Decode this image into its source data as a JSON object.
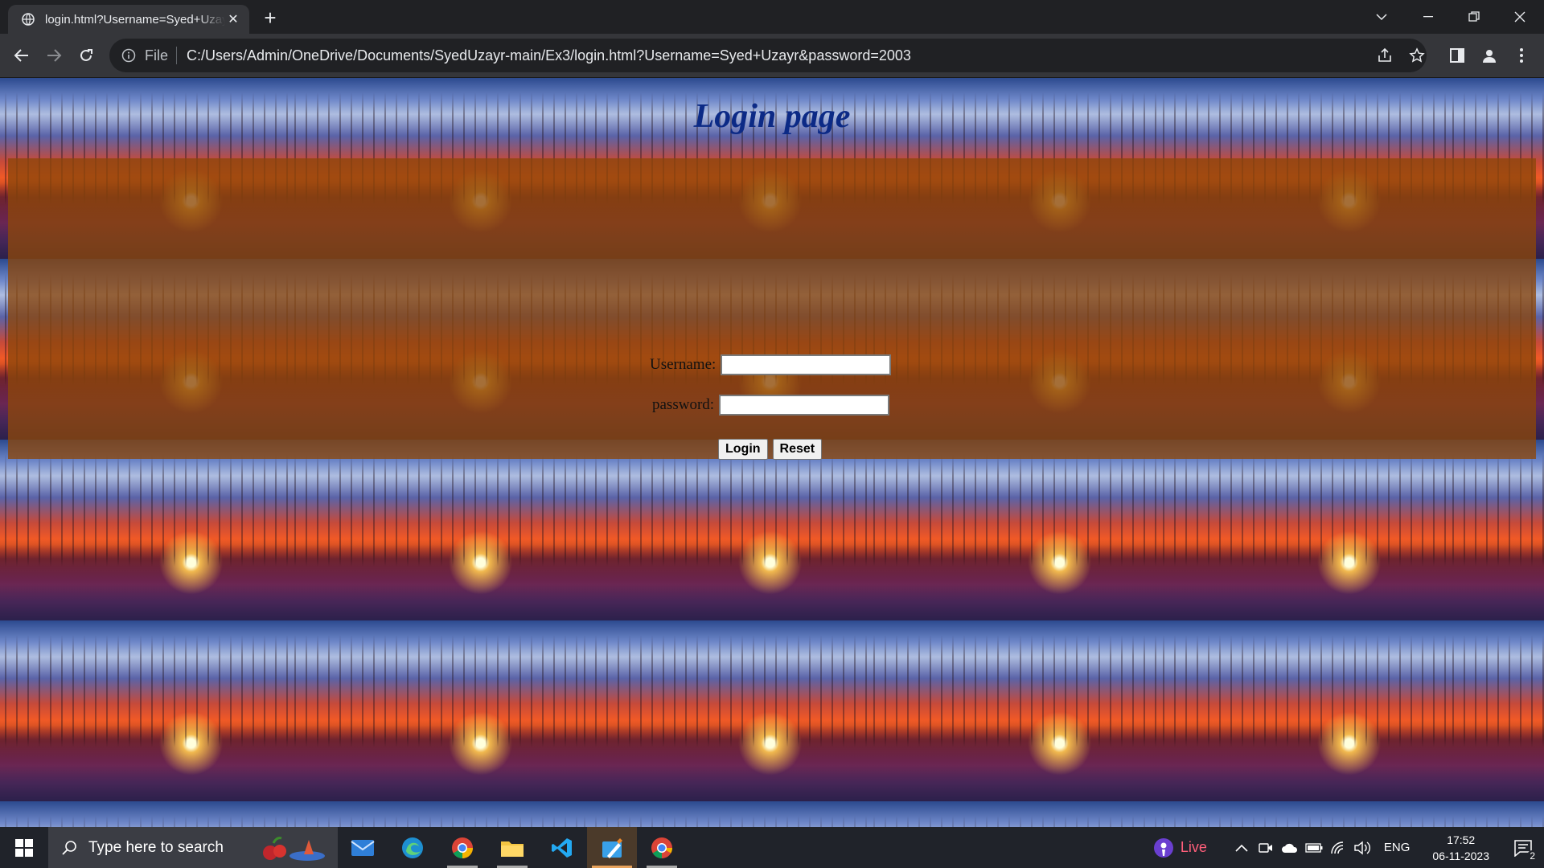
{
  "browser": {
    "tab_title": "login.html?Username=Syed+Uzayr",
    "file_label": "File",
    "url": "C:/Users/Admin/OneDrive/Documents/SyedUzayr-main/Ex3/login.html?Username=Syed+Uzayr&password=2003"
  },
  "page": {
    "heading": "Login page",
    "username_label": "Username:",
    "password_label": "password:",
    "username_value": "",
    "password_value": "",
    "login_button": "Login",
    "reset_button": "Reset"
  },
  "taskbar": {
    "search_placeholder": "Type here to search",
    "live_label": "Live",
    "language": "ENG",
    "time": "17:52",
    "date": "06-11-2023",
    "notification_count": "2",
    "apps": [
      "mail-icon",
      "edge-icon",
      "chrome-icon",
      "file-explorer-icon",
      "vscode-icon",
      "paint-icon",
      "chrome-icon"
    ]
  },
  "colors": {
    "heading": "#0c2a86",
    "panel": "#8c460a",
    "chrome_bg": "#202124",
    "toolbar_bg": "#35363a",
    "live_accent": "#ff5f7a"
  }
}
